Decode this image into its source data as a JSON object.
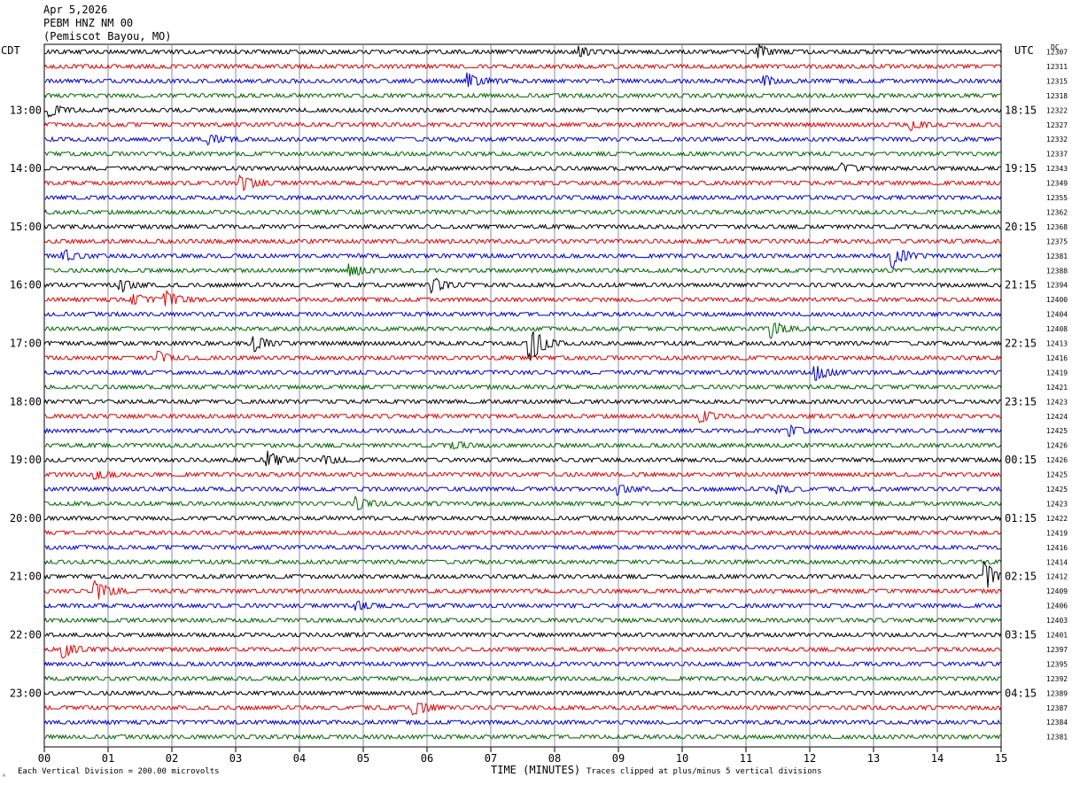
{
  "header": {
    "date": "Apr 5,2026",
    "station": "PEBM HNZ NM 00",
    "location": "(Pemiscot Bayou, MO)"
  },
  "left_timezone": "CDT",
  "right_timezone": "UTC",
  "dc_header": "DC",
  "footer": {
    "scale_note": "Each Vertical Division =  200.00 microvolts",
    "clip_note": "Traces clipped at plus/minus 5 vertical divisions",
    "corner_mark": "ᴬ"
  },
  "colors": {
    "trace_cycle": [
      "#000000",
      "#dd0000",
      "#0000cc",
      "#006600"
    ],
    "grid": "#8888aa"
  },
  "chart_data": {
    "type": "line",
    "title": "",
    "xlabel": "TIME (MINUTES)",
    "xlim": [
      0,
      15
    ],
    "x_ticks": [
      "00",
      "01",
      "02",
      "03",
      "04",
      "05",
      "06",
      "07",
      "08",
      "09",
      "10",
      "11",
      "12",
      "13",
      "14",
      "15"
    ],
    "left_hour_labels": [
      "13:00",
      "14:00",
      "15:00",
      "16:00",
      "17:00",
      "18:00",
      "19:00",
      "20:00",
      "21:00",
      "22:00",
      "23:00"
    ],
    "right_hour_labels": [
      "18:15",
      "19:15",
      "20:15",
      "21:15",
      "22:15",
      "23:15",
      "00:15",
      "01:15",
      "02:15",
      "03:15",
      "04:15"
    ],
    "first_labeled_trace_index": 4,
    "traces_per_hour": 4,
    "trace_count": 48,
    "dc_offsets": [
      12307,
      12311,
      12315,
      12318,
      12322,
      12327,
      12332,
      12337,
      12343,
      12349,
      12355,
      12362,
      12368,
      12375,
      12381,
      12388,
      12394,
      12400,
      12404,
      12408,
      12413,
      12416,
      12419,
      12421,
      12423,
      12424,
      12425,
      12426,
      12426,
      12425,
      12425,
      12423,
      12422,
      12419,
      12416,
      12414,
      12412,
      12409,
      12406,
      12403,
      12401,
      12397,
      12395,
      12392,
      12389,
      12387,
      12384,
      12381
    ],
    "events": [
      {
        "trace": 0,
        "minute": 8.4,
        "amplitude": 0.3
      },
      {
        "trace": 0,
        "minute": 11.2,
        "amplitude": 0.4
      },
      {
        "trace": 2,
        "minute": 6.65,
        "amplitude": 0.6
      },
      {
        "trace": 2,
        "minute": 11.3,
        "amplitude": 0.3
      },
      {
        "trace": 4,
        "minute": 0.1,
        "amplitude": 0.4
      },
      {
        "trace": 5,
        "minute": 13.6,
        "amplitude": 0.3
      },
      {
        "trace": 6,
        "minute": 2.6,
        "amplitude": 0.3
      },
      {
        "trace": 8,
        "minute": 12.5,
        "amplitude": 0.3
      },
      {
        "trace": 9,
        "minute": 3.1,
        "amplitude": 0.5
      },
      {
        "trace": 14,
        "minute": 0.3,
        "amplitude": 0.4
      },
      {
        "trace": 14,
        "minute": 13.3,
        "amplitude": 0.8
      },
      {
        "trace": 15,
        "minute": 4.8,
        "amplitude": 0.4
      },
      {
        "trace": 16,
        "minute": 1.2,
        "amplitude": 0.4
      },
      {
        "trace": 16,
        "minute": 6.1,
        "amplitude": 0.5
      },
      {
        "trace": 17,
        "minute": 1.4,
        "amplitude": 0.4
      },
      {
        "trace": 17,
        "minute": 1.9,
        "amplitude": 0.6
      },
      {
        "trace": 19,
        "minute": 11.4,
        "amplitude": 0.6
      },
      {
        "trace": 20,
        "minute": 3.3,
        "amplitude": 0.5
      },
      {
        "trace": 20,
        "minute": 7.62,
        "amplitude": 1.3
      },
      {
        "trace": 21,
        "minute": 1.8,
        "amplitude": 0.4
      },
      {
        "trace": 22,
        "minute": 12.1,
        "amplitude": 0.5
      },
      {
        "trace": 25,
        "minute": 10.3,
        "amplitude": 0.4
      },
      {
        "trace": 26,
        "minute": 11.7,
        "amplitude": 0.4
      },
      {
        "trace": 27,
        "minute": 6.4,
        "amplitude": 0.3
      },
      {
        "trace": 28,
        "minute": 3.5,
        "amplitude": 0.6
      },
      {
        "trace": 28,
        "minute": 4.4,
        "amplitude": 0.3
      },
      {
        "trace": 29,
        "minute": 0.8,
        "amplitude": 0.3
      },
      {
        "trace": 30,
        "minute": 9.0,
        "amplitude": 0.3
      },
      {
        "trace": 30,
        "minute": 11.5,
        "amplitude": 0.3
      },
      {
        "trace": 31,
        "minute": 4.9,
        "amplitude": 0.4
      },
      {
        "trace": 36,
        "minute": 14.75,
        "amplitude": 1.0
      },
      {
        "trace": 37,
        "minute": 0.8,
        "amplitude": 0.8
      },
      {
        "trace": 38,
        "minute": 4.9,
        "amplitude": 0.3
      },
      {
        "trace": 41,
        "minute": 0.3,
        "amplitude": 0.5
      },
      {
        "trace": 45,
        "minute": 5.8,
        "amplitude": 0.5
      }
    ]
  }
}
